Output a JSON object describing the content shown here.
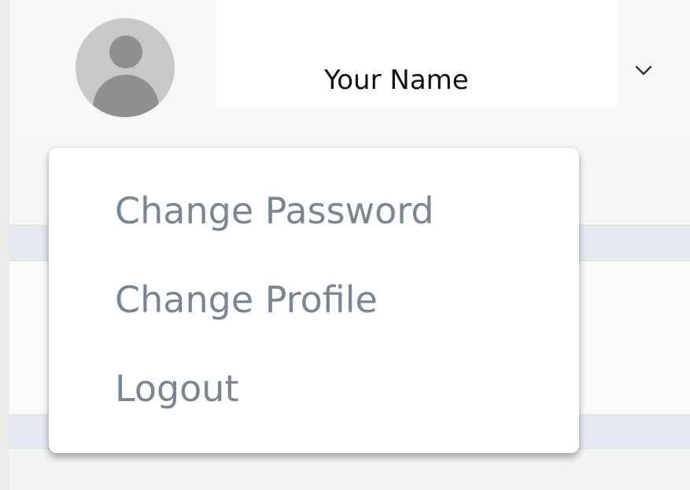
{
  "header": {
    "user_name": "Your Name",
    "avatar_icon": "user-avatar-icon",
    "toggle_icon": "chevron-down-icon"
  },
  "dropdown": {
    "items": [
      {
        "label": "Change Password"
      },
      {
        "label": "Change Profile"
      },
      {
        "label": "Logout"
      }
    ]
  },
  "colors": {
    "menu_text": "#7b8790",
    "name_text": "#111111",
    "avatar_bg": "#c8c8c8",
    "avatar_fg": "#8f8f8f",
    "band": "#e6e9f2"
  }
}
